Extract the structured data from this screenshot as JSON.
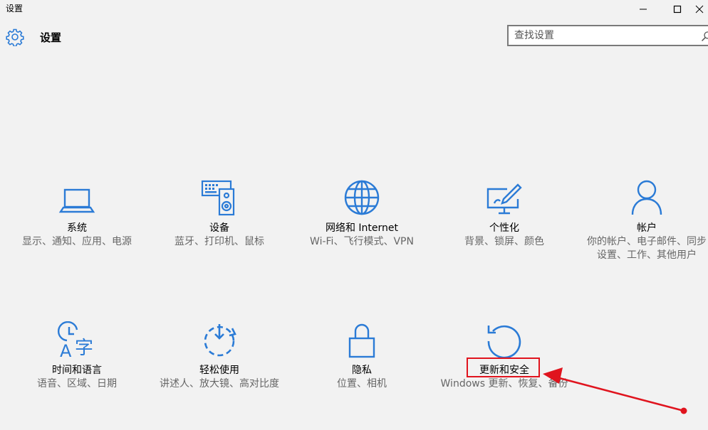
{
  "window": {
    "title": "设置",
    "controls": [
      "minimize-icon",
      "maximize-icon",
      "close-icon"
    ]
  },
  "header": {
    "icon": "gear-icon",
    "title": "设置"
  },
  "search": {
    "placeholder": "查找设置",
    "value": "",
    "icon": "search-icon"
  },
  "categories": [
    {
      "icon": "laptop-icon",
      "name": "系统",
      "desc": "显示、通知、应用、电源"
    },
    {
      "icon": "devices-icon",
      "name": "设备",
      "desc": "蓝牙、打印机、鼠标"
    },
    {
      "icon": "globe-icon",
      "name": "网络和 Internet",
      "desc": "Wi-Fi、飞行模式、VPN"
    },
    {
      "icon": "personalization-icon",
      "name": "个性化",
      "desc": "背景、锁屏、颜色"
    },
    {
      "icon": "person-icon",
      "name": "帐户",
      "desc": "你的帐户、电子邮件、同步设置、工作、其他用户"
    },
    {
      "icon": "time-language-icon",
      "name": "时间和语言",
      "desc": "语音、区域、日期"
    },
    {
      "icon": "ease-of-access-icon",
      "name": "轻松使用",
      "desc": "讲述人、放大镜、高对比度"
    },
    {
      "icon": "lock-icon",
      "name": "隐私",
      "desc": "位置、相机"
    },
    {
      "icon": "update-icon",
      "name": "更新和安全",
      "desc": "Windows 更新、恢复、备份"
    }
  ],
  "annotation": {
    "color": "#e0141e"
  },
  "colors": {
    "accent": "#2b7bd6",
    "background": "#f2f2f2"
  }
}
